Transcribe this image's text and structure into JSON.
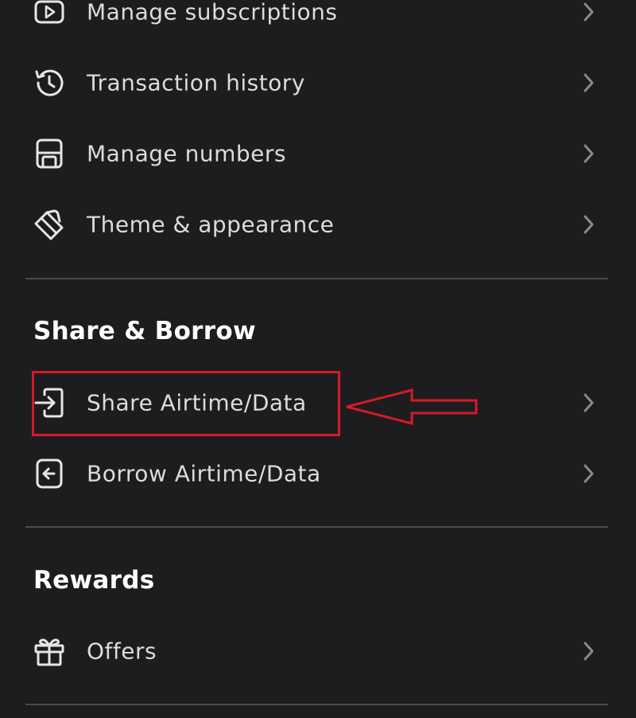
{
  "menu_top": [
    {
      "label": "Manage subscriptions",
      "icon": "play-icon"
    },
    {
      "label": "Transaction history",
      "icon": "history-icon"
    },
    {
      "label": "Manage numbers",
      "icon": "sim-card-icon"
    },
    {
      "label": "Theme & appearance",
      "icon": "paint-bucket-icon"
    }
  ],
  "share_borrow": {
    "title": "Share & Borrow",
    "items": [
      {
        "label": "Share Airtime/Data",
        "icon": "share-icon"
      },
      {
        "label": "Borrow Airtime/Data",
        "icon": "borrow-icon"
      }
    ]
  },
  "rewards": {
    "title": "Rewards",
    "items": [
      {
        "label": "Offers",
        "icon": "gift-icon"
      }
    ]
  },
  "colors": {
    "background": "#1d1d1f",
    "text": "#dcdcdc",
    "heading": "#ffffff",
    "divider": "#4a4a4a",
    "chevron": "#8a8a8a",
    "annotation": "#d51a27"
  }
}
